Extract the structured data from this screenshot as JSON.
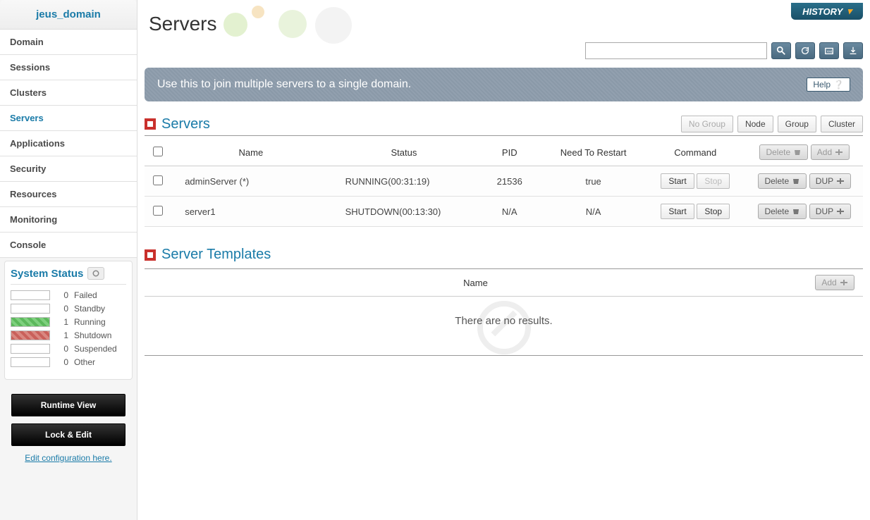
{
  "header": {
    "domain_name": "jeus_domain",
    "history_label": "HISTORY"
  },
  "sidebar": {
    "items": [
      {
        "label": "Domain"
      },
      {
        "label": "Sessions"
      },
      {
        "label": "Clusters"
      },
      {
        "label": "Servers",
        "active": true
      },
      {
        "label": "Applications"
      },
      {
        "label": "Security"
      },
      {
        "label": "Resources"
      },
      {
        "label": "Monitoring"
      },
      {
        "label": "Console"
      }
    ],
    "status_title": "System Status",
    "status_items": [
      {
        "count": "0",
        "label": "Failed",
        "cls": ""
      },
      {
        "count": "0",
        "label": "Standby",
        "cls": ""
      },
      {
        "count": "1",
        "label": "Running",
        "cls": "running"
      },
      {
        "count": "1",
        "label": "Shutdown",
        "cls": "shutdown"
      },
      {
        "count": "0",
        "label": "Suspended",
        "cls": ""
      },
      {
        "count": "0",
        "label": "Other",
        "cls": ""
      }
    ],
    "runtime_btn": "Runtime View",
    "lock_btn": "Lock & Edit",
    "edit_link": "Edit configuration here."
  },
  "page": {
    "title": "Servers",
    "banner_text": "Use this to join multiple servers to a single domain.",
    "help_label": "Help"
  },
  "servers_section": {
    "title": "Servers",
    "view_buttons": [
      "No Group",
      "Node",
      "Group",
      "Cluster"
    ],
    "columns": [
      "",
      "Name",
      "Status",
      "PID",
      "Need To Restart",
      "Command",
      ""
    ],
    "header_actions": {
      "delete": "Delete",
      "add": "Add"
    },
    "rows": [
      {
        "name": "adminServer (*)",
        "status": "RUNNING(00:31:19)",
        "pid": "21536",
        "restart": "true",
        "start_disabled": false,
        "stop_disabled": true
      },
      {
        "name": "server1",
        "status": "SHUTDOWN(00:13:30)",
        "pid": "N/A",
        "restart": "N/A",
        "start_disabled": false,
        "stop_disabled": false
      }
    ],
    "row_actions": {
      "start": "Start",
      "stop": "Stop",
      "delete": "Delete",
      "dup": "DUP"
    }
  },
  "templates_section": {
    "title": "Server Templates",
    "column": "Name",
    "add_label": "Add",
    "empty_text": "There are no results."
  }
}
